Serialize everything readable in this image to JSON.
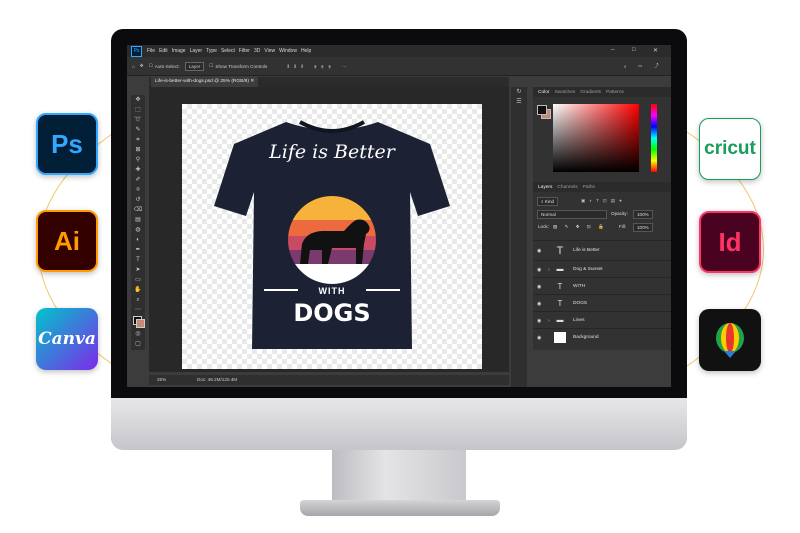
{
  "app_tiles": {
    "ps": "Ps",
    "ai": "Ai",
    "canva": "Canva",
    "cricut": "cricut",
    "id": "Id"
  },
  "menu": [
    "File",
    "Edit",
    "Image",
    "Layer",
    "Type",
    "Select",
    "Filter",
    "3D",
    "View",
    "Window",
    "Help"
  ],
  "options_bar": {
    "auto_select": "Auto-Select:",
    "auto_select_value": "Layer",
    "show_transform": "Show Transform Controls"
  },
  "document": {
    "tab_title": "Life-is-better-with-dogs.psd @ 25% (RGB/8)",
    "zoom": "25%",
    "doc_size": "Doc: 48.2M/120.4M"
  },
  "artwork": {
    "line1": "Life is Better",
    "line2": "WITH",
    "line3": "DOGS"
  },
  "color_panel": {
    "tabs": [
      "Color",
      "Swatches",
      "Gradients",
      "Patterns"
    ]
  },
  "layers_panel": {
    "tabs": [
      "Layers",
      "Channels",
      "Paths"
    ],
    "filter": "Kind",
    "blend_mode": "Normal",
    "opacity_label": "Opacity:",
    "opacity_value": "100%",
    "lock_label": "Lock:",
    "fill_label": "Fill:",
    "fill_value": "100%",
    "layers": [
      {
        "name": "Life is Better",
        "kind": "text"
      },
      {
        "name": "Dog & Sunset",
        "kind": "group"
      },
      {
        "name": "WITH",
        "kind": "text"
      },
      {
        "name": "DOGS",
        "kind": "text"
      },
      {
        "name": "Lines",
        "kind": "group"
      },
      {
        "name": "Background",
        "kind": "image"
      }
    ]
  },
  "colors": {
    "shirt": "#1c2233",
    "sunset": [
      "#f6b23a",
      "#ec6a3e",
      "#c84a63",
      "#7b3a6e"
    ],
    "background_swatch": "#c48a76"
  }
}
